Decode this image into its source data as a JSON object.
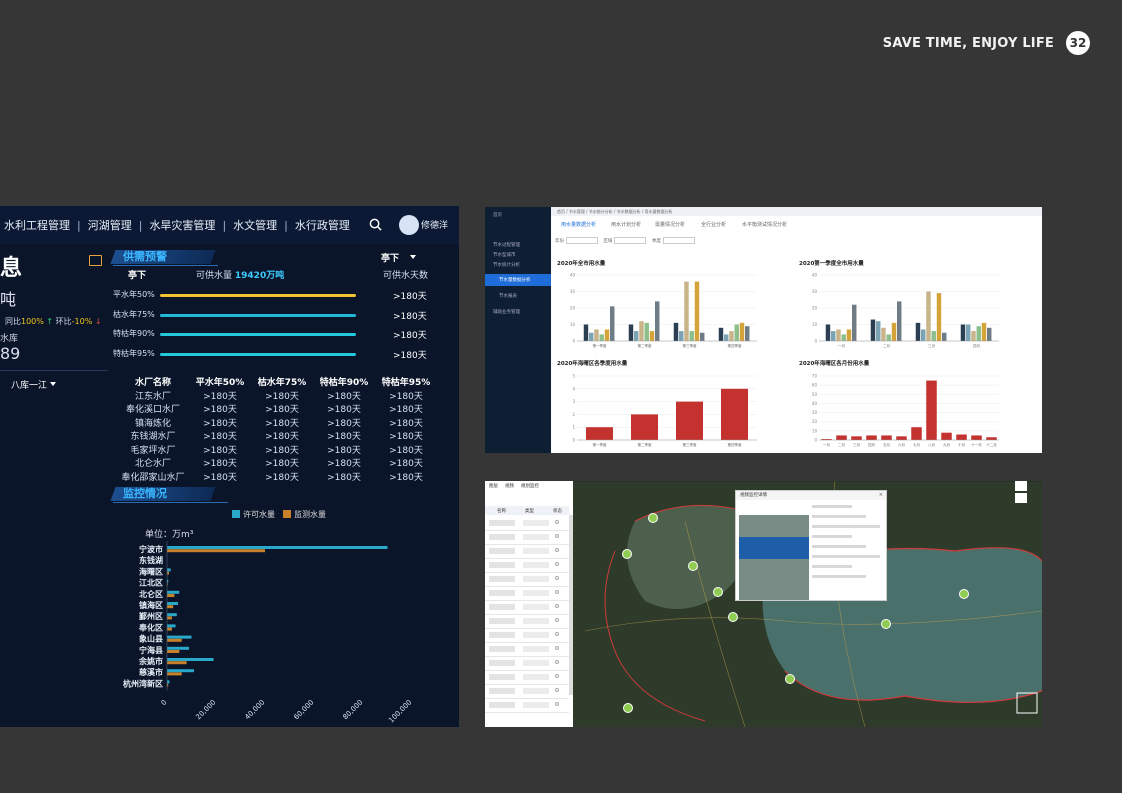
{
  "slide": {
    "slogan": "SAVE TIME, ENJOY LIFE",
    "page_number": "32"
  },
  "dashboard": {
    "nav": [
      "水利工程管理",
      "河湖管理",
      "水旱灾害管理",
      "水文管理",
      "水行政管理"
    ],
    "nav_sep": "|",
    "user_name": "修德洋",
    "left_fragments": {
      "info_char": "息",
      "unit": "吨",
      "yoy_label": "同比",
      "yoy_value": "100%",
      "qoq_label": "环比",
      "qoq_value": "-10%",
      "reservoir": "水库",
      "reservoir_value": "89",
      "dropdown": "八库一江"
    },
    "supply": {
      "header": "供需预警",
      "station": "亭下",
      "station_select": "亭下",
      "available_label": "可供水量",
      "available_value": "19420万吨",
      "days_label": "可供水天数",
      "rows": [
        {
          "label": "平水年50%",
          "value": ">180天",
          "color": "#f2c230",
          "fill": 1.0
        },
        {
          "label": "枯水年75%",
          "value": ">180天",
          "color": "#22b8d8",
          "fill": 1.0
        },
        {
          "label": "特枯年90%",
          "value": ">180天",
          "color": "#22c8dc",
          "fill": 1.0
        },
        {
          "label": "特枯年95%",
          "value": ">180天",
          "color": "#22c8dc",
          "fill": 1.0
        }
      ]
    },
    "table": {
      "headers": [
        "水厂名称",
        "平水年50%",
        "枯水年75%",
        "特枯年90%",
        "特枯年95%"
      ],
      "rows": [
        [
          "江东水厂",
          ">180天",
          ">180天",
          ">180天",
          ">180天"
        ],
        [
          "奉化溪口水厂",
          ">180天",
          ">180天",
          ">180天",
          ">180天"
        ],
        [
          "镇海炼化",
          ">180天",
          ">180天",
          ">180天",
          ">180天"
        ],
        [
          "东钱湖水厂",
          ">180天",
          ">180天",
          ">180天",
          ">180天"
        ],
        [
          "毛家坪水厂",
          ">180天",
          ">180天",
          ">180天",
          ">180天"
        ],
        [
          "北仑水厂",
          ">180天",
          ">180天",
          ">180天",
          ">180天"
        ],
        [
          "奉化邵家山水厂",
          ">180天",
          ">180天",
          ">180天",
          ">180天"
        ]
      ]
    },
    "monitor": {
      "header": "监控情况",
      "legend": [
        {
          "name": "许可水量",
          "color": "#2aa8c9"
        },
        {
          "name": "监测水量",
          "color": "#c9822a"
        }
      ],
      "unit": "单位：万m³"
    }
  },
  "chart_data": [
    {
      "type": "bar",
      "orientation": "horizontal",
      "categories": [
        "宁波市",
        "东钱湖",
        "海曙区",
        "江北区",
        "北仑区",
        "镇海区",
        "鄞州区",
        "奉化区",
        "象山县",
        "宁海县",
        "余姚市",
        "慈溪市",
        "杭州湾新区"
      ],
      "series": [
        {
          "name": "许可水量",
          "values": [
            90000,
            0,
            1500,
            500,
            5000,
            4500,
            4000,
            3500,
            10000,
            9000,
            19000,
            11000,
            1000
          ]
        },
        {
          "name": "监测水量",
          "values": [
            40000,
            0,
            800,
            300,
            3000,
            2500,
            2000,
            2000,
            6000,
            5000,
            8000,
            6000,
            500
          ]
        }
      ],
      "xlim": [
        0,
        100000
      ],
      "xticks": [
        "0",
        "20,000",
        "40,000",
        "60,000",
        "80,000",
        "100,000"
      ]
    },
    {
      "type": "bar",
      "title": "2020年全市用水量",
      "categories": [
        "第一季度",
        "第二季度",
        "第三季度",
        "第四季度"
      ],
      "series_colors": [
        "#2b3f52",
        "#7aa4b5",
        "#c9b48a",
        "#8dbf8c",
        "#d4a33a",
        "#6f7c86"
      ],
      "values": [
        [
          10,
          5,
          7,
          4,
          7,
          21
        ],
        [
          10,
          6,
          12,
          11,
          6,
          24
        ],
        [
          11,
          6,
          36,
          6,
          36,
          5
        ],
        [
          8,
          4,
          6,
          10,
          11,
          9
        ]
      ],
      "ylim": [
        0,
        40
      ],
      "yticks": [
        "0",
        "10",
        "20",
        "30",
        "40"
      ]
    },
    {
      "type": "bar",
      "title": "2020第一季度全市用水量",
      "categories": [
        "一月",
        "二月",
        "三月",
        "四月"
      ],
      "series_colors": [
        "#2b3f52",
        "#7aa4b5",
        "#c9b48a",
        "#8dbf8c",
        "#d4a33a",
        "#6f7c86"
      ],
      "values": [
        [
          10,
          6,
          7,
          4,
          7,
          22
        ],
        [
          13,
          12,
          8,
          4,
          11,
          24
        ],
        [
          11,
          7,
          30,
          6,
          29,
          5
        ],
        [
          10,
          10,
          6,
          9,
          11,
          8
        ]
      ],
      "ylim": [
        0,
        40
      ],
      "yticks": [
        "0",
        "10",
        "20",
        "30",
        "40"
      ]
    },
    {
      "type": "bar",
      "title": "2020年海曙区各季度用水量",
      "categories": [
        "第一季度",
        "第二季度",
        "第三季度",
        "第四季度"
      ],
      "values": [
        1,
        2,
        3,
        4
      ],
      "color": "#c4322f",
      "ylim": [
        0,
        5
      ],
      "yticks": [
        "0",
        "1",
        "2",
        "3",
        "4",
        "5"
      ]
    },
    {
      "type": "bar",
      "title": "2020年海曙区各月份用水量",
      "categories": [
        "一月",
        "二月",
        "三月",
        "四月",
        "五月",
        "六月",
        "七月",
        "八月",
        "九月",
        "十月",
        "十一月",
        "十二月"
      ],
      "values": [
        1,
        5,
        4,
        5,
        5,
        4,
        14,
        65,
        8,
        6,
        5,
        3
      ],
      "color": "#c4322f",
      "ylim": [
        0,
        70
      ],
      "yticks": [
        "0",
        "10",
        "20",
        "30",
        "40",
        "50",
        "60",
        "70"
      ]
    }
  ],
  "analysis_app": {
    "sidebar": [
      "首页",
      "节水过程管理",
      "节水型城市",
      "节水统计分析",
      "节水量数据分析",
      "节水报表",
      "辅助业务管理"
    ],
    "breadcrumb": "首页 / 节水管理 / 节水统计分析 / 节水数据分析 / 用水量数据分析",
    "tabs": [
      "用水量数据分析",
      "用水计划分析",
      "需量情况分析",
      "全行业分析",
      "水平衡测试情况分析"
    ],
    "filters": {
      "year_label": "年份",
      "year_value": "2020",
      "area_label": "区域",
      "area_value": "全部区域",
      "quarter_label": "季度",
      "quarter_value": "第一季度"
    }
  },
  "map_app": {
    "tabs": [
      "图层",
      "视频",
      "规划监控"
    ],
    "headers": [
      "名称",
      "类型",
      "状态"
    ],
    "popup_title": "视频监控详情",
    "rows": 14,
    "marker_count": 9
  }
}
